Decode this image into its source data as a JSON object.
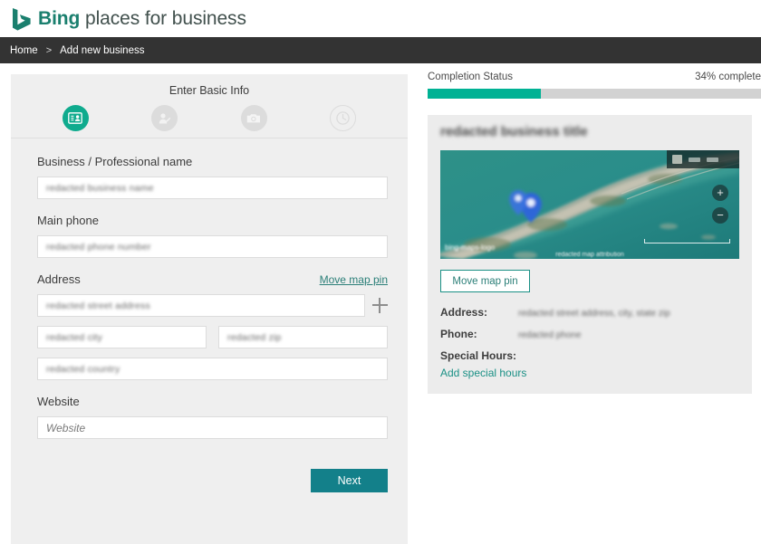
{
  "header": {
    "brand_bold": "Bing",
    "brand_rest": " places for business",
    "logo_icon": "bing-logo-icon"
  },
  "breadcrumb": {
    "home": "Home",
    "separator": ">",
    "current": "Add new business"
  },
  "stepper": {
    "title": "Enter Basic Info",
    "steps": [
      {
        "icon": "contact-card-icon",
        "state": "active"
      },
      {
        "icon": "person-edit-icon",
        "state": "inactive"
      },
      {
        "icon": "camera-icon",
        "state": "inactive"
      },
      {
        "icon": "clock-icon",
        "state": "outline"
      }
    ]
  },
  "form": {
    "business_name": {
      "label": "Business / Professional name",
      "value": "redacted business name",
      "placeholder": ""
    },
    "main_phone": {
      "label": "Main phone",
      "value": "redacted phone number",
      "placeholder": ""
    },
    "address": {
      "label": "Address",
      "move_map_pin_link": "Move map pin",
      "street": {
        "value": "redacted street address"
      },
      "city": {
        "value": "redacted city"
      },
      "zip": {
        "value": "redacted zip"
      },
      "country": {
        "value": "redacted country"
      },
      "add_line_icon": "plus-icon"
    },
    "website": {
      "label": "Website",
      "value": "",
      "placeholder": "Website"
    },
    "next_button": "Next"
  },
  "completion": {
    "label": "Completion Status",
    "percent_text": "34% complete",
    "percent": 34,
    "fill_color": "#00b294",
    "track_color": "#d2d2d2"
  },
  "preview": {
    "business_title": "redacted business title",
    "map": {
      "type": "satellite-map",
      "pin_icon": "map-pin-icon",
      "zoom_in_label": "+",
      "zoom_out_label": "−",
      "attribution": "redacted map attribution",
      "logo": "bing-maps-logo"
    },
    "move_map_pin_button": "Move map pin",
    "details": [
      {
        "key": "Address:",
        "value": "redacted street address, city, state zip"
      },
      {
        "key": "Phone:",
        "value": "redacted phone"
      }
    ],
    "special_hours_label": "Special Hours:",
    "add_special_hours_link": "Add special hours"
  },
  "colors": {
    "brand_teal": "#1a7f6e",
    "accent_teal": "#0fab8e",
    "button_teal": "#13808a",
    "progress_green": "#00b294",
    "breadcrumb_bar": "#333333",
    "panel_gray": "#efefef"
  }
}
